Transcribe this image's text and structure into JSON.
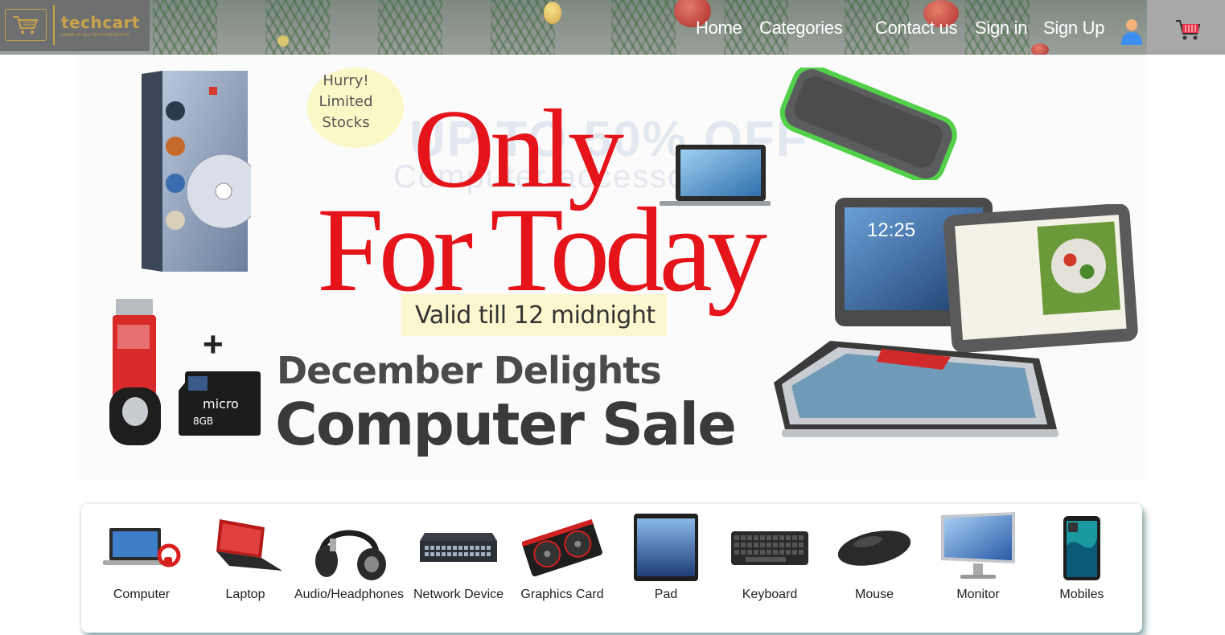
{
  "header": {
    "brand_name": "techcart",
    "brand_tagline": "HOME OF ALL TECH PRODUCTS",
    "nav": {
      "home": "Home",
      "categories": "Categories",
      "contact": "Contact us",
      "signin": "Sign in",
      "signup": "Sign Up"
    },
    "icons": {
      "user": "user-icon",
      "cart": "shopping-cart-icon",
      "logo": "cart-logo-icon"
    }
  },
  "banner": {
    "bg_line1": "UP TO 50% OFF",
    "bg_line2": "Computer accessories",
    "hurry": "Hurry!\nLimited\nStocks",
    "headline1": "Only",
    "headline2": "For Today",
    "valid": "Valid till 12 midnight",
    "subtitle": "December Delights",
    "title": "Computer Sale",
    "plus": "+",
    "tablet_clock": "12:25",
    "accent_color": "#e5141b"
  },
  "categories": [
    {
      "label": "Computer",
      "icon": "computer-icon"
    },
    {
      "label": "Laptop",
      "icon": "laptop-icon"
    },
    {
      "label": "Audio/Headphones",
      "icon": "headphones-icon"
    },
    {
      "label": "Network Device",
      "icon": "network-switch-icon"
    },
    {
      "label": "Graphics Card",
      "icon": "graphics-card-icon"
    },
    {
      "label": "Pad",
      "icon": "tablet-icon"
    },
    {
      "label": "Keyboard",
      "icon": "keyboard-icon"
    },
    {
      "label": "Mouse",
      "icon": "mouse-icon"
    },
    {
      "label": "Monitor",
      "icon": "monitor-icon"
    },
    {
      "label": "Mobiles",
      "icon": "smartphone-icon"
    }
  ]
}
